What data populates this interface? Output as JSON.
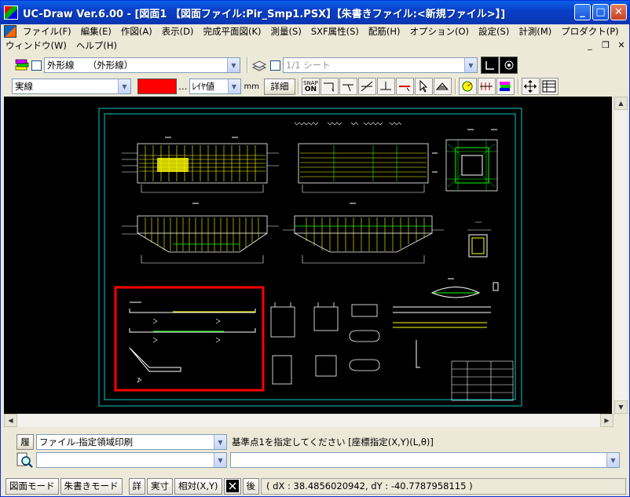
{
  "window": {
    "title": "UC-Draw Ver.6.00 - [図面1 【図面ファイル:Pir_Smp1.PSX】【朱書きファイル:<新規ファイル>】]",
    "minimize": "_",
    "maximize": "□",
    "close": "✕"
  },
  "menu": {
    "items": [
      "ファイル(F)",
      "編集(E)",
      "作図(A)",
      "表示(D)",
      "完成平面図(K)",
      "測量(S)",
      "SXF属性(S)",
      "配筋(H)",
      "オプション(O)",
      "設定(S)",
      "計測(M)",
      "プロダクト(P)"
    ],
    "row2": [
      "ウィンドウ(W)",
      "ヘルプ(H)"
    ],
    "mdi_min": "_",
    "mdi_restore": "❐",
    "mdi_close": "✕"
  },
  "toolbar1": {
    "layer_value": "外形線　　（外形線）",
    "sheet_value": "1/1 シート"
  },
  "toolbar2": {
    "linetype_value": "実線",
    "color_hex": "#ff0000",
    "color_more": "…",
    "width_value": "ﾚｲﾔ値",
    "unit": "mm",
    "detail_button": "詳細",
    "snap_label_top": "SNAP",
    "snap_label_bottom": "ON"
  },
  "command": {
    "history_button": "履",
    "mode_value": "ファイル-指定領域印刷",
    "prompt": "基準点1を指定してください [座標指定(X,Y)(L,θ)]",
    "input_value": ""
  },
  "status": {
    "drawing_mode": "図面モード",
    "redline_mode": "朱書きモード",
    "detail": "詳",
    "actual_size": "実寸",
    "relative": "相対(X,Y)",
    "after": "後",
    "readout": "( dX : 38.4856020942, dY : -40.7787958115 )"
  },
  "colors": {
    "canvas_bg": "#000000",
    "frame": "#00c8c8",
    "drawing": "#ffffff",
    "rebar": "#ffff00",
    "accent": "#00ff00",
    "selection": "#ff0000"
  }
}
